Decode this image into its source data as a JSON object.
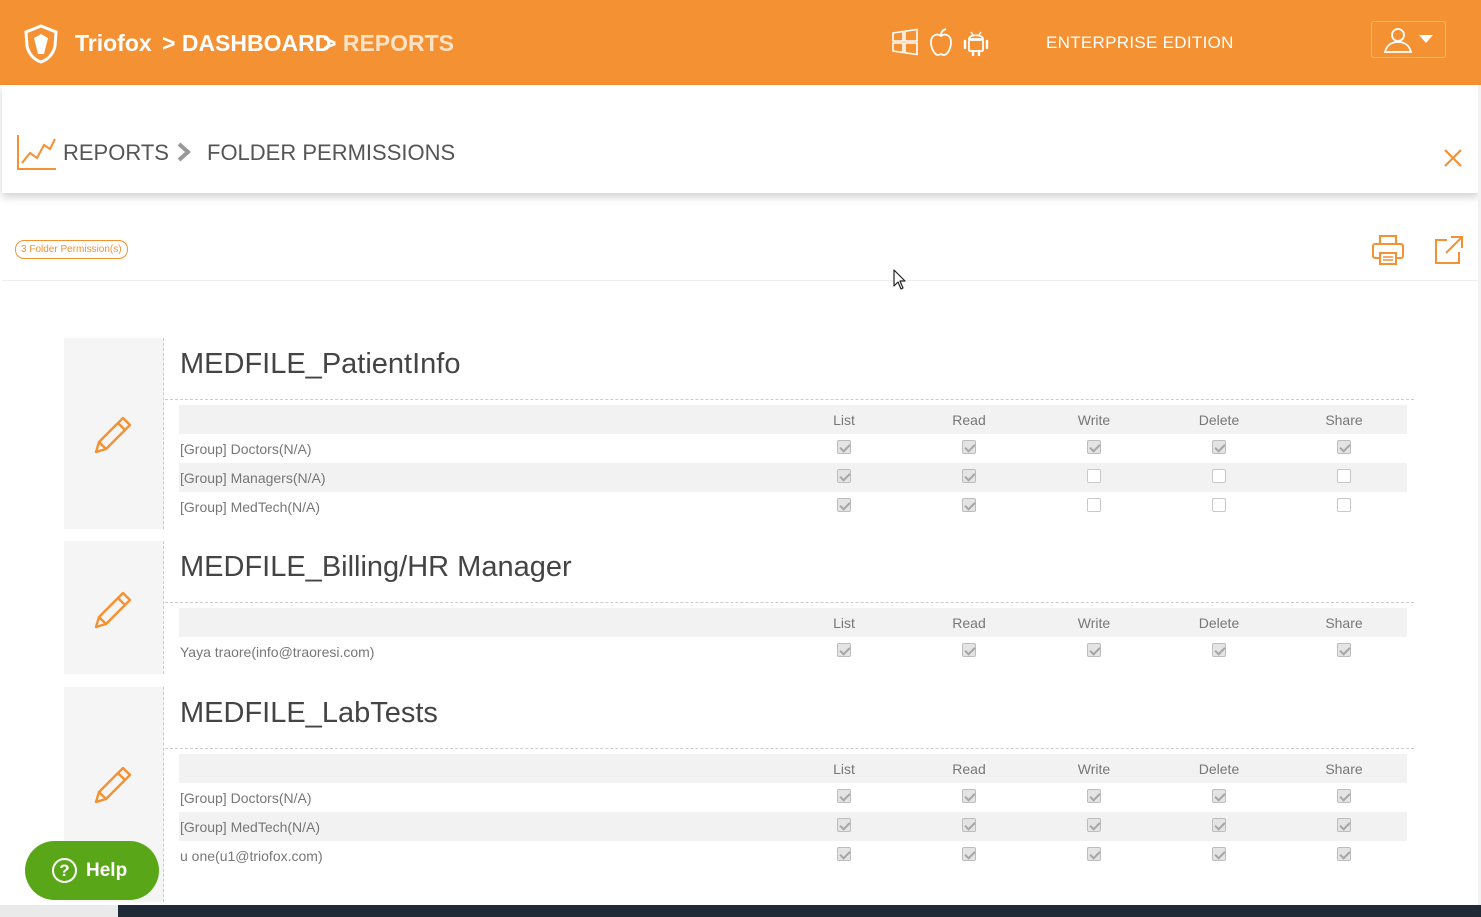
{
  "header": {
    "brand": "Triofox",
    "crumb_sep": ">",
    "crumb_dashboard": "DASHBOARD",
    "crumb_reports": "REPORTS",
    "edition": "ENTERPRISE EDITION",
    "colors": {
      "accent": "#f49132",
      "help": "#5aa619"
    }
  },
  "subheader": {
    "reports": "REPORTS",
    "page": "FOLDER PERMISSIONS"
  },
  "toolbar": {
    "count_badge": "3 Folder Permission(s)"
  },
  "columns": [
    "List",
    "Read",
    "Write",
    "Delete",
    "Share"
  ],
  "folders": [
    {
      "name": "MEDFILE_PatientInfo",
      "rows": [
        {
          "name": "[Group] Doctors(N/A)",
          "perms": [
            true,
            true,
            true,
            true,
            true
          ]
        },
        {
          "name": "[Group] Managers(N/A)",
          "perms": [
            true,
            true,
            false,
            false,
            false
          ]
        },
        {
          "name": "[Group] MedTech(N/A)",
          "perms": [
            true,
            true,
            false,
            false,
            false
          ]
        }
      ]
    },
    {
      "name": "MEDFILE_Billing/HR Manager",
      "rows": [
        {
          "name": "Yaya traore(info@traoresi.com)",
          "perms": [
            true,
            true,
            true,
            true,
            true
          ]
        }
      ]
    },
    {
      "name": "MEDFILE_LabTests",
      "rows": [
        {
          "name": "[Group] Doctors(N/A)",
          "perms": [
            true,
            true,
            true,
            true,
            true
          ]
        },
        {
          "name": "[Group] MedTech(N/A)",
          "perms": [
            true,
            true,
            true,
            true,
            true
          ]
        },
        {
          "name": "u one(u1@triofox.com)",
          "perms": [
            true,
            true,
            true,
            true,
            true
          ]
        }
      ]
    }
  ],
  "help": {
    "label": "Help",
    "glyph": "?"
  }
}
